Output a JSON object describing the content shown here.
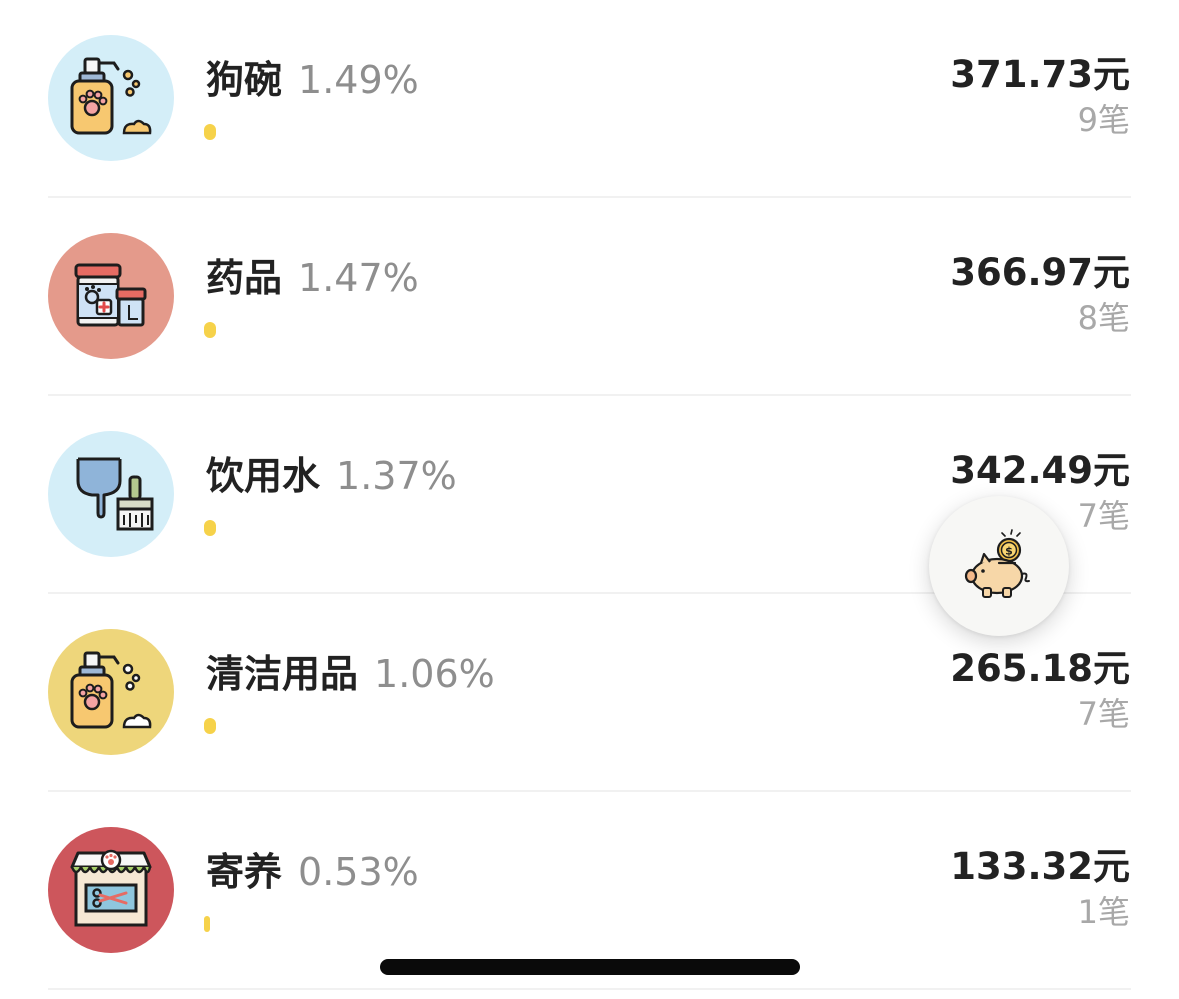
{
  "colors": {
    "accent_bar": "#f6d24a",
    "name_text": "#222222",
    "percent_text": "#8e8e8e",
    "count_text": "#a8a8a8"
  },
  "items": [
    {
      "name": "狗碗",
      "percent": "1.49%",
      "share": 1.49,
      "amount": "371.73元",
      "count": "9笔",
      "icon": "pet-shampoo-bottle-icon",
      "icon_bg": "#d4eef8"
    },
    {
      "name": "药品",
      "percent": "1.47%",
      "share": 1.47,
      "amount": "366.97元",
      "count": "8笔",
      "icon": "pet-medicine-jar-icon",
      "icon_bg": "#e49a8b"
    },
    {
      "name": "饮用水",
      "percent": "1.37%",
      "share": 1.37,
      "amount": "342.49元",
      "count": "7笔",
      "icon": "scooper-brush-icon",
      "icon_bg": "#d4eef8"
    },
    {
      "name": "清洁用品",
      "percent": "1.06%",
      "share": 1.06,
      "amount": "265.18元",
      "count": "7笔",
      "icon": "pet-shampoo-bottle-icon",
      "icon_bg": "#eed67b"
    },
    {
      "name": "寄养",
      "percent": "0.53%",
      "share": 0.53,
      "amount": "133.32元",
      "count": "1笔",
      "icon": "pet-shop-icon",
      "icon_bg": "#cd565c"
    }
  ],
  "fab": {
    "icon": "piggy-bank-coin-icon"
  }
}
